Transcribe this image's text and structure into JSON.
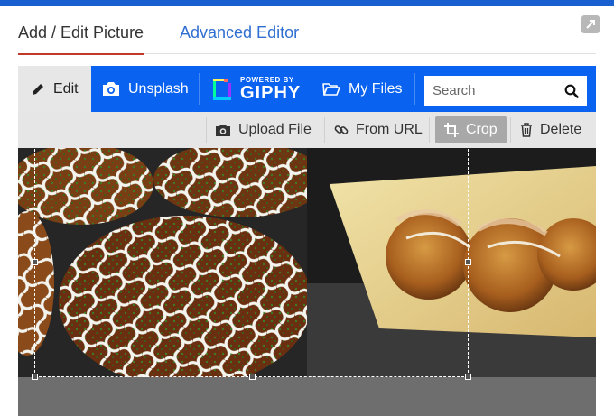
{
  "dialog": {
    "tabs": [
      {
        "label": "Add / Edit Picture",
        "active": true
      },
      {
        "label": "Advanced Editor",
        "active": false
      }
    ],
    "expand_icon": "expand-arrow-icon"
  },
  "toolbar": {
    "edit_label": "Edit",
    "unsplash_label": "Unsplash",
    "giphy_powered": "POWERED BY",
    "giphy_brand": "GIPHY",
    "my_files_label": "My Files",
    "search_placeholder": "Search"
  },
  "actions": {
    "upload_label": "Upload File",
    "url_label": "From URL",
    "crop_label": "Crop",
    "delete_label": "Delete"
  },
  "colors": {
    "toolbar_bg": "#0a63f0",
    "active_tab_underline": "#c0392b",
    "link_blue": "#2f6fd1"
  }
}
